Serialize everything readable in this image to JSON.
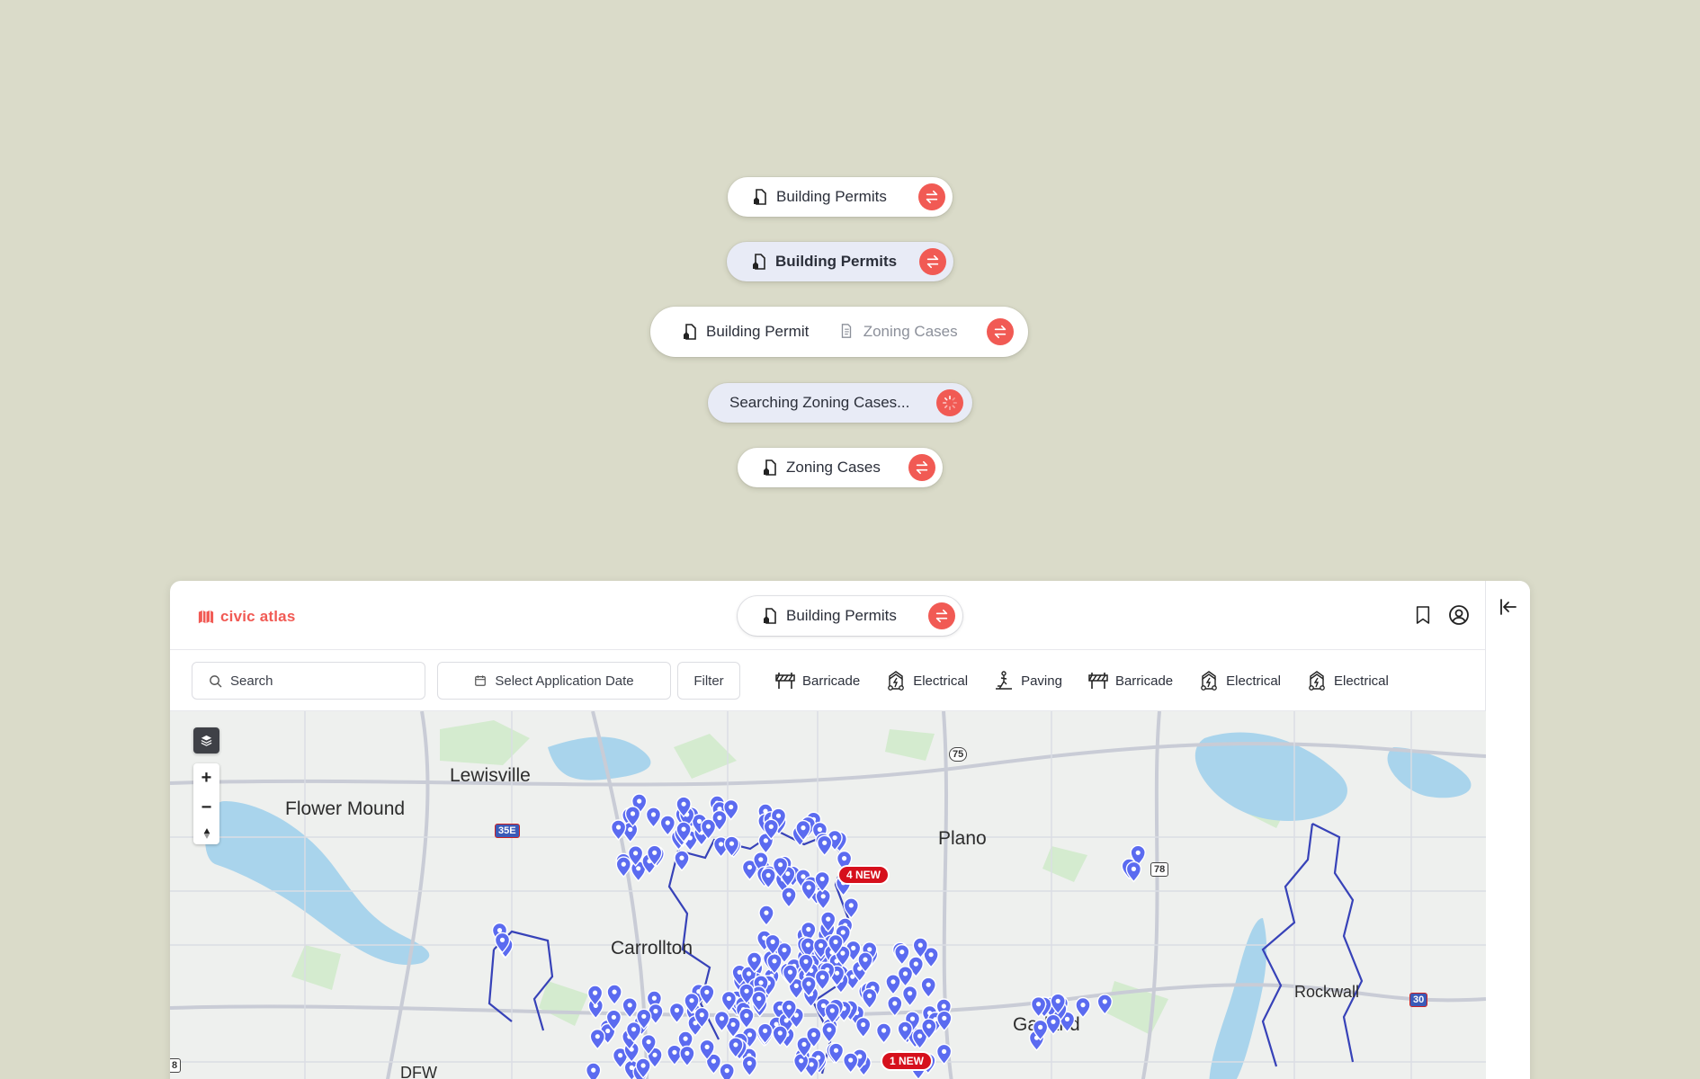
{
  "showcase": {
    "pill_1": {
      "label": "Building Permits"
    },
    "pill_2": {
      "label": "Building Permits"
    },
    "pill_3": {
      "primary": "Building Permit",
      "secondary": "Zoning Cases"
    },
    "pill_4": {
      "label": "Searching Zoning Cases..."
    },
    "pill_5": {
      "label": "Zoning Cases"
    }
  },
  "app": {
    "logo_text": "civic atlas",
    "dataset_switch": {
      "label": "Building Permits"
    },
    "toolbar": {
      "search_placeholder": "Search",
      "date_label": "Select Application Date",
      "filter_label": "Filter",
      "categories": [
        {
          "label": "Barricade",
          "icon": "barricade-icon"
        },
        {
          "label": "Electrical",
          "icon": "electrical-icon"
        },
        {
          "label": "Paving",
          "icon": "paving-icon"
        },
        {
          "label": "Barricade",
          "icon": "barricade-icon"
        },
        {
          "label": "Electrical",
          "icon": "electrical-icon"
        },
        {
          "label": "Electrical",
          "icon": "electrical-icon"
        }
      ]
    },
    "map": {
      "zoom_in": "+",
      "zoom_out": "−",
      "places": [
        "Lewisville",
        "Flower Mound",
        "Plano",
        "Carrollton",
        "Garland",
        "Rockwall",
        "DFW"
      ],
      "badges": [
        "4 NEW",
        "1 NEW"
      ],
      "shields": [
        "75",
        "35E",
        "78",
        "30",
        "8"
      ]
    }
  },
  "colors": {
    "accent": "#f15a54",
    "pin": "#5b6bf0",
    "boundary": "#3742b8",
    "water": "#a9d4ec",
    "background": "#dadbc9"
  }
}
